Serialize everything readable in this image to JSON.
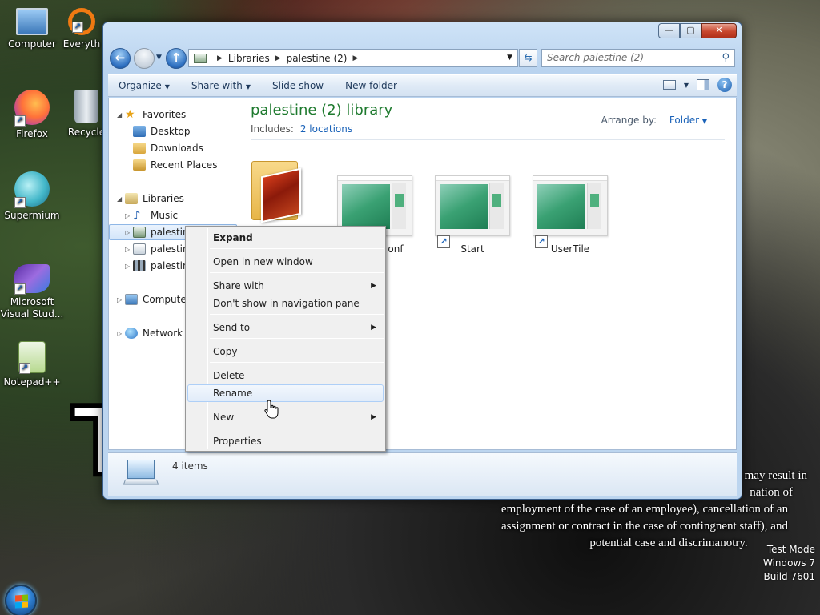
{
  "desktop": {
    "icons": [
      {
        "label": "Computer"
      },
      {
        "label": "Everyth"
      },
      {
        "label": "Firefox"
      },
      {
        "label": "Recycle"
      },
      {
        "label": "Supermium"
      },
      {
        "label": "Microsoft Visual Stud..."
      },
      {
        "label": "Notepad++"
      }
    ],
    "watermark": {
      "subtitle_lines": [
        "may result in",
        "nation of",
        "employment of the case of an employee), cancellation of an",
        "assignment or contract in the case of contingnent staff), and",
        "potential case and discrimanotry."
      ],
      "test_mode": [
        "Test Mode",
        "Windows 7",
        "Build 7601"
      ]
    }
  },
  "window": {
    "caption": {
      "minimize": "—",
      "maximize": "▢",
      "close": "✕"
    },
    "breadcrumb": [
      "Libraries",
      "palestine (2)"
    ],
    "search_placeholder": "Search palestine (2)",
    "toolbar": {
      "organize": "Organize",
      "share_with": "Share with",
      "slide_show": "Slide show",
      "new_folder": "New folder"
    },
    "nav_pane": {
      "favorites": "Favorites",
      "desktop": "Desktop",
      "downloads": "Downloads",
      "recent_places": "Recent Places",
      "libraries": "Libraries",
      "music": "Music",
      "palestine_1": "palestine",
      "palestine_2": "palestine",
      "palestine_3": "palestine",
      "computer": "Computer",
      "network": "Network"
    },
    "library": {
      "title": "palestine (2) library",
      "includes_label": "Includes:",
      "includes_link": "2 locations",
      "arrange_label": "Arrange by:",
      "arrange_value": "Folder"
    },
    "files": [
      {
        "name": "",
        "kind": "folder"
      },
      {
        "name": "onf",
        "kind": "shortcut"
      },
      {
        "name": "Start",
        "kind": "shortcut"
      },
      {
        "name": "UserTile",
        "kind": "shortcut"
      }
    ],
    "status": {
      "count": "4 items"
    }
  },
  "context_menu": {
    "expand": "Expand",
    "open_new_window": "Open in new window",
    "share_with": "Share with",
    "dont_show": "Don't show in navigation pane",
    "send_to": "Send to",
    "copy": "Copy",
    "delete": "Delete",
    "rename": "Rename",
    "new": "New",
    "properties": "Properties"
  }
}
